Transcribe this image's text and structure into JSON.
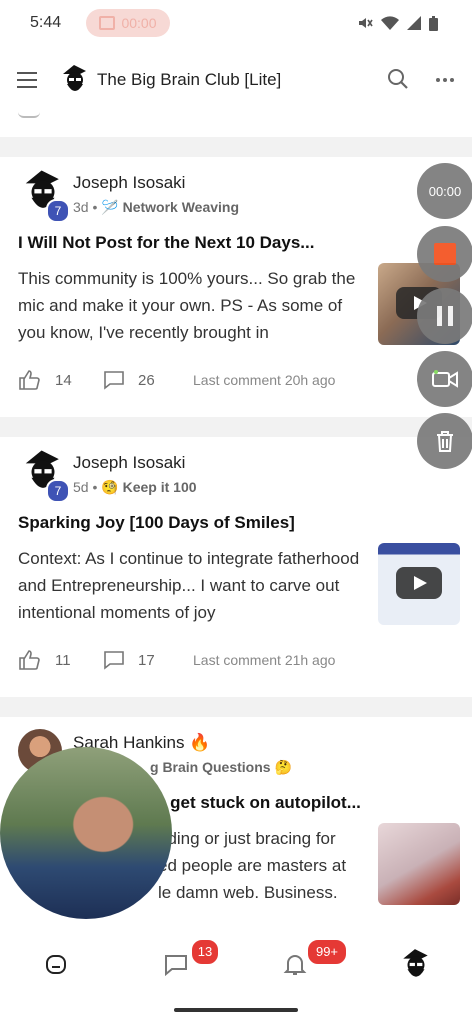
{
  "status_bar": {
    "time": "5:44",
    "recording_timer": "00:00"
  },
  "app_bar": {
    "title": "The Big Brain Club [Lite]"
  },
  "posts": [
    {
      "author": "Joseph Isosaki",
      "level": "7",
      "age": "3d",
      "category": "Network Weaving",
      "category_icon": "🪡",
      "title": "I Will Not Post for the Next 10 Days...",
      "excerpt": "This community is 100% yours... So grab the mic and make it your own. PS - As some of you know, I've recently brought in",
      "likes": "14",
      "comments": "26",
      "last_comment": "Last comment 20h ago"
    },
    {
      "author": "Joseph Isosaki",
      "level": "7",
      "age": "5d",
      "category": "Keep it 100",
      "category_icon": "🧐",
      "title": "Sparking Joy [100 Days of Smiles]",
      "excerpt": "Context: As I continue to integrate fatherhood and Entrepreneurship... I want to carve out intentional moments of joy",
      "likes": "11",
      "comments": "17",
      "last_comment": "Last comment 21h ago"
    },
    {
      "author": "Sarah Hankins 🔥",
      "category": "g Brain Questions",
      "category_icon": "🤔",
      "title": "n get stuck on autopilot...",
      "excerpt_lines": [
        "ading or just bracing for",
        "ed people are masters at",
        "le damn web. Business."
      ]
    }
  ],
  "recorder": {
    "timer": "00:00"
  },
  "bottom_nav": {
    "chat_badge": "13",
    "notif_badge": "99+"
  },
  "colors": {
    "badge_red": "#e53935",
    "level_blue": "#3f53b5",
    "record_red": "#f4511e"
  }
}
